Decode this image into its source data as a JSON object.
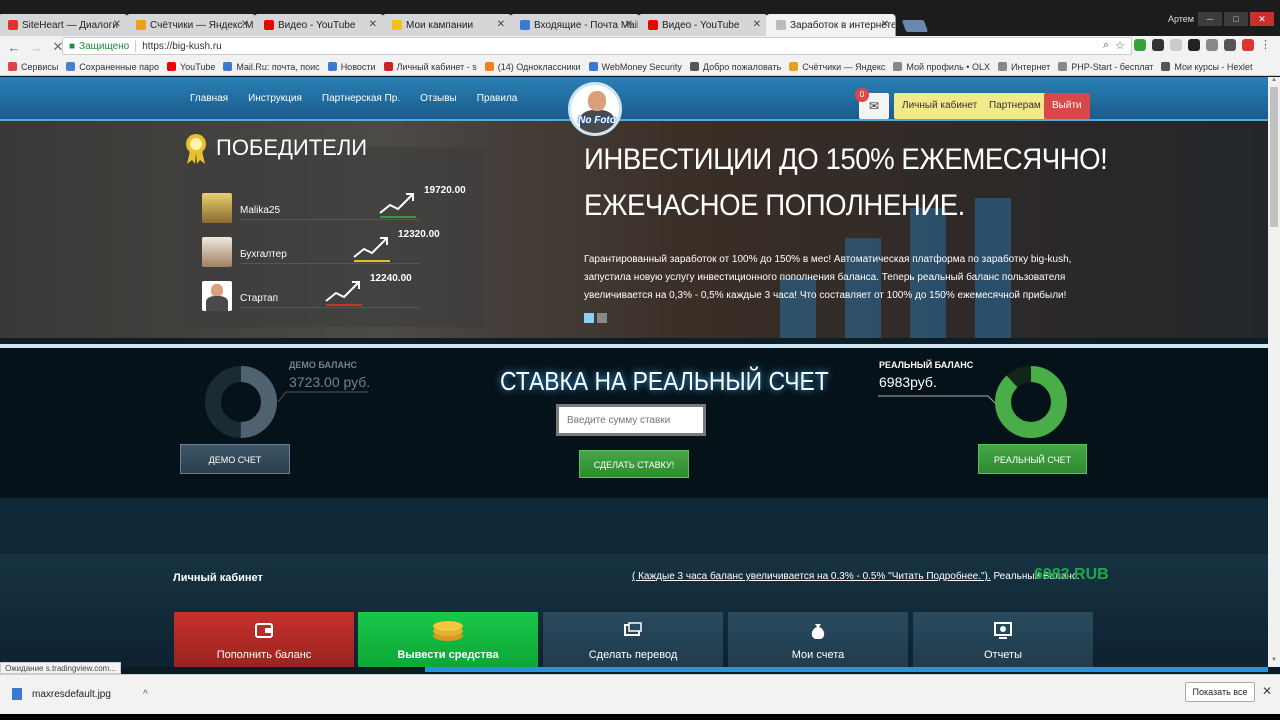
{
  "browser": {
    "tabs": [
      {
        "label": "SiteHeart — Диалоги",
        "color": "#d33"
      },
      {
        "label": "Счётчики — Яндекс.Ме",
        "color": "#e8a020"
      },
      {
        "label": "Видео - YouTube",
        "color": "#e00"
      },
      {
        "label": "Мои кампании",
        "color": "#f0c020"
      },
      {
        "label": "Входящие - Почта Mail.",
        "color": "#3a7ad0"
      },
      {
        "label": "Видео - YouTube",
        "color": "#e00"
      },
      {
        "label": "Заработок в интернете",
        "color": "#999",
        "active": true
      }
    ],
    "user": "Артем",
    "secure_label": "Защищено",
    "url": "https://big-kush.ru",
    "bookmarks": [
      {
        "label": "Сервисы",
        "color": "#d44"
      },
      {
        "label": "Сохраненные паро",
        "color": "#4a80d0"
      },
      {
        "label": "YouTube",
        "color": "#e00"
      },
      {
        "label": "Mail.Ru: почта, поис",
        "color": "#3a7ad0"
      },
      {
        "label": "Новости",
        "color": "#3a7ad0"
      },
      {
        "label": "Личный кабинет - s",
        "color": "#c22"
      },
      {
        "label": "(14) Одноклассники",
        "color": "#f08020"
      },
      {
        "label": "WebMoney Security",
        "color": "#3a7ad0"
      },
      {
        "label": "Добро пожаловать",
        "color": "#555"
      },
      {
        "label": "Счётчики — Яндекс",
        "color": "#e8a020"
      },
      {
        "label": "Мой профиль • OLX",
        "color": "#888"
      },
      {
        "label": "Интернет",
        "color": "#888"
      },
      {
        "label": "PHP-Start - бесплат",
        "color": "#888"
      },
      {
        "label": "Мои курсы - Hexlet",
        "color": "#555"
      }
    ],
    "status_text": "Ожидание s.tradingview.com...",
    "download_file": "maxresdefault.jpg",
    "show_all": "Показать все"
  },
  "site": {
    "nav": [
      "Главная",
      "Инструкция",
      "Партнерская Пр.",
      "Отзывы",
      "Правила"
    ],
    "avatar_text": "No Foto",
    "mail_count": "0",
    "btn_cabinet": "Личный кабинет",
    "btn_partners": "Партнерам",
    "btn_logout": "Выйти",
    "winners_title": "ПОБЕДИТЕЛИ",
    "winners": [
      {
        "name": "Malika25",
        "amount": "19720.00",
        "color": "#3a9a3a"
      },
      {
        "name": "Бухгалтер",
        "amount": "12320.00",
        "color": "#e0c020"
      },
      {
        "name": "Стартап",
        "amount": "12240.00",
        "color": "#d03030"
      }
    ],
    "hero_h1": "ИНВЕСТИЦИИ ДО 150% ЕЖЕМЕСЯЧНО!",
    "hero_h2": "ЕЖЕЧАСНОЕ ПОПОЛНЕНИЕ.",
    "hero_p": "Гарантированный заработок от 100% до 150% в мес! Автоматическая платформа по заработку big-kush, запустила новую услугу инвестиционного пополнения баланса. Теперь реальный баланс пользователя увеличивается на 0,3% - 0,5% каждые 3 часа! Что составляет от 100% до 150% ежемесячной прибыли!",
    "demo_label": "ДЕМО БАЛАНС",
    "demo_value": "3723.00 руб.",
    "demo_button": "ДЕМО СЧЕТ",
    "bet_title": "СТАВКА НА РЕАЛЬНЫЙ СЧЕТ",
    "bet_placeholder": "Введите сумму ставки",
    "bet_button": "СДЕЛАТЬ СТАВКУ!",
    "real_label": "РЕАЛЬНЫЙ БАЛАНС",
    "real_value": "6983руб.",
    "real_button": "РЕАЛЬНЫЙ СЧЕТ",
    "demo_fill": 0.5,
    "real_fill": 0.88,
    "cabinet_title": "Личный кабинет",
    "cabinet_note": "( Каждые 3 часа баланс увеличивается на 0.3% - 0.5% \"Читать Подробнее.\").",
    "cabinet_real_label": "Реальный Баланс:",
    "cabinet_rub": "6983 RUB",
    "tiles": [
      {
        "label": "Пополнить баланс",
        "icon": "wallet-icon"
      },
      {
        "label": "Вывести средства",
        "icon": "coins-icon"
      },
      {
        "label": "Сделать перевод",
        "icon": "transfer-icon"
      },
      {
        "label": "Мои счета",
        "icon": "money-bag-icon"
      },
      {
        "label": "Отчеты",
        "icon": "report-icon"
      }
    ]
  }
}
